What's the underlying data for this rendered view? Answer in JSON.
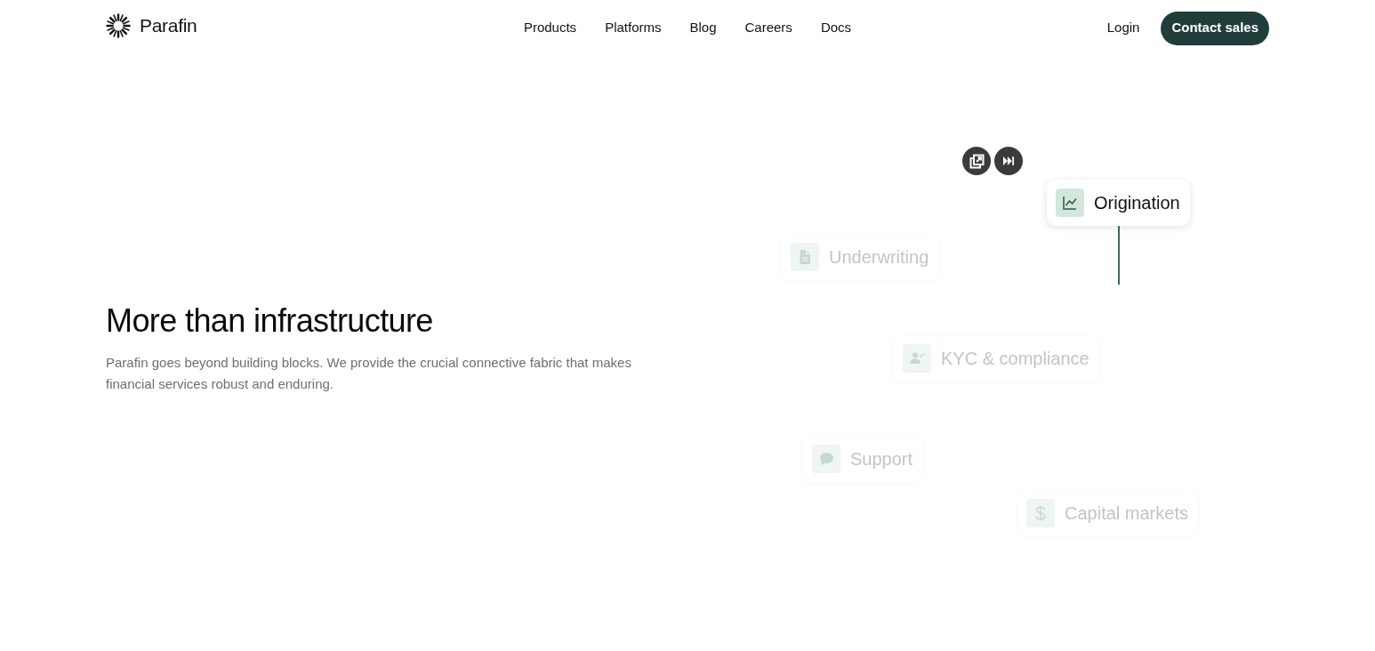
{
  "navbar": {
    "brand": "Parafin",
    "links": [
      "Products",
      "Platforms",
      "Blog",
      "Careers",
      "Docs"
    ],
    "login": "Login",
    "cta": "Contact sales"
  },
  "hero": {
    "title": "More than infrastructure",
    "description": "Parafin goes beyond building blocks. We provide the crucial connective fabric that makes financial services robust and enduring."
  },
  "diagram": {
    "nodes": [
      {
        "label": "Origination",
        "active": true
      },
      {
        "label": "Underwriting",
        "active": false
      },
      {
        "label": "KYC & compliance",
        "active": false
      },
      {
        "label": "Support",
        "active": false
      },
      {
        "label": "Capital markets",
        "active": false
      }
    ]
  }
}
